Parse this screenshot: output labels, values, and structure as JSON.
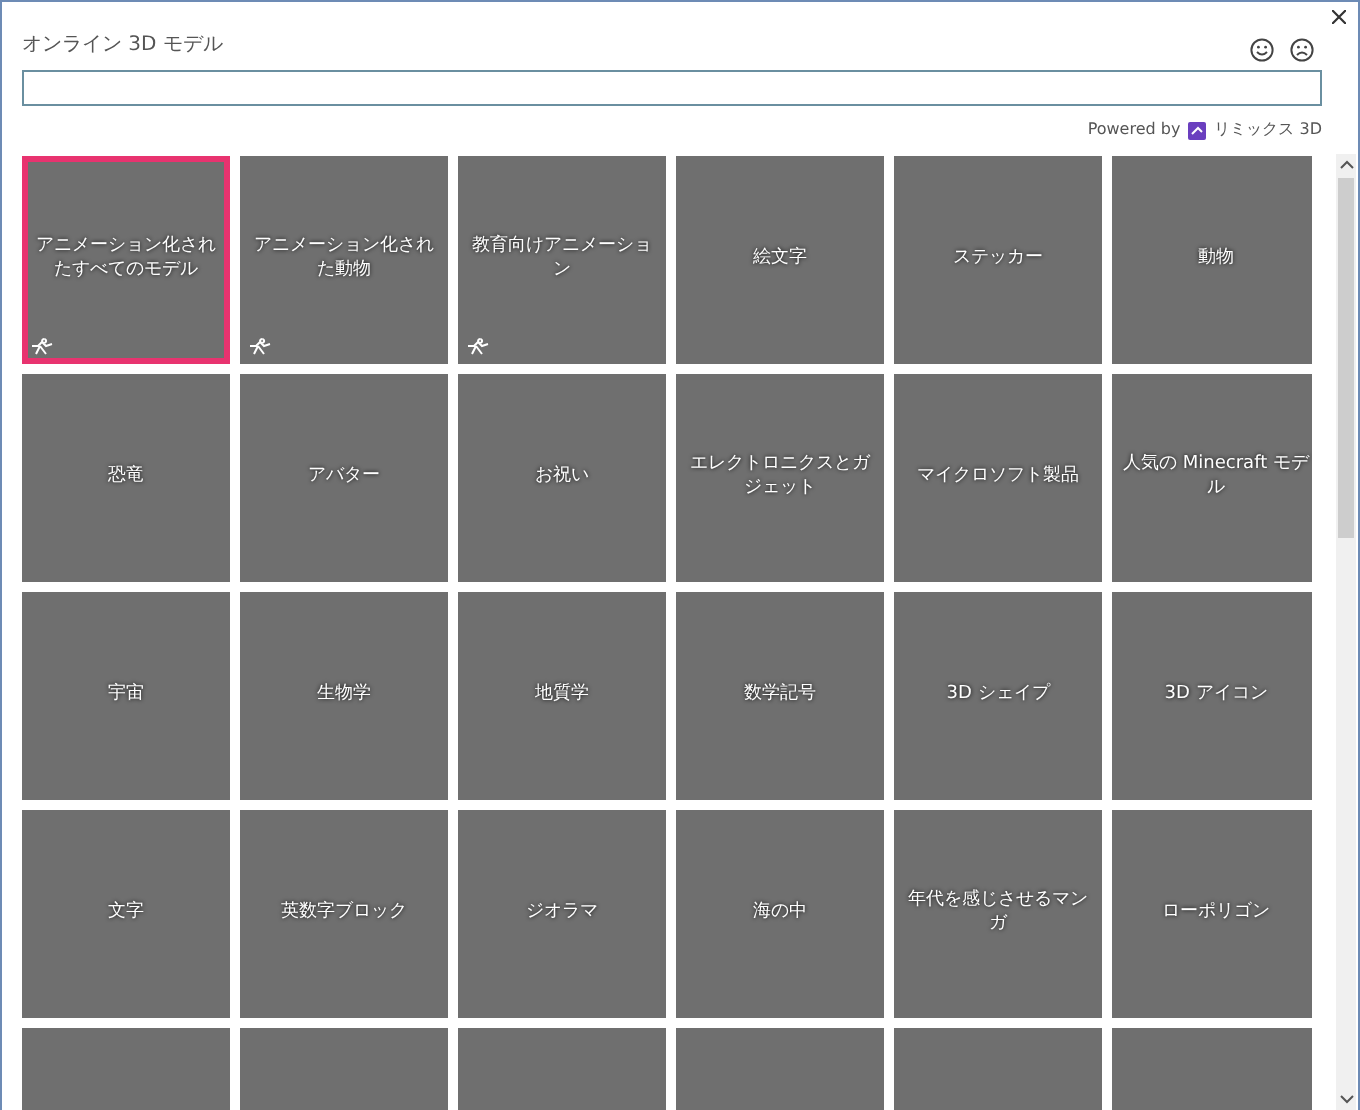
{
  "window": {
    "title": "オンライン 3D モデル"
  },
  "powered_by": {
    "text": "Powered by",
    "brand": "リミックス 3D"
  },
  "tiles": [
    {
      "label": "アニメーション化されたすべてのモデル",
      "selected": true,
      "animated": true
    },
    {
      "label": "アニメーション化された動物",
      "selected": false,
      "animated": true
    },
    {
      "label": "教育向けアニメーション",
      "selected": false,
      "animated": true
    },
    {
      "label": "絵文字",
      "selected": false,
      "animated": false
    },
    {
      "label": "ステッカー",
      "selected": false,
      "animated": false
    },
    {
      "label": "動物",
      "selected": false,
      "animated": false
    },
    {
      "label": "恐竜",
      "selected": false,
      "animated": false
    },
    {
      "label": "アバター",
      "selected": false,
      "animated": false
    },
    {
      "label": "お祝い",
      "selected": false,
      "animated": false
    },
    {
      "label": "エレクトロニクスとガジェット",
      "selected": false,
      "animated": false
    },
    {
      "label": "マイクロソフト製品",
      "selected": false,
      "animated": false
    },
    {
      "label": "人気の Minecraft モデル",
      "selected": false,
      "animated": false
    },
    {
      "label": "宇宙",
      "selected": false,
      "animated": false
    },
    {
      "label": "生物学",
      "selected": false,
      "animated": false
    },
    {
      "label": "地質学",
      "selected": false,
      "animated": false
    },
    {
      "label": "数学記号",
      "selected": false,
      "animated": false
    },
    {
      "label": "3D シェイプ",
      "selected": false,
      "animated": false
    },
    {
      "label": "3D アイコン",
      "selected": false,
      "animated": false
    },
    {
      "label": "文字",
      "selected": false,
      "animated": false
    },
    {
      "label": "英数字ブロック",
      "selected": false,
      "animated": false
    },
    {
      "label": "ジオラマ",
      "selected": false,
      "animated": false
    },
    {
      "label": "海の中",
      "selected": false,
      "animated": false
    },
    {
      "label": "年代を感じさせるマンガ",
      "selected": false,
      "animated": false
    },
    {
      "label": "ローポリゴン",
      "selected": false,
      "animated": false
    },
    {
      "selected": false,
      "animated": false
    },
    {
      "selected": false,
      "animated": false
    },
    {
      "selected": false,
      "animated": false
    },
    {
      "selected": false,
      "animated": false
    },
    {
      "selected": false,
      "animated": false
    },
    {
      "selected": false,
      "animated": false
    }
  ]
}
